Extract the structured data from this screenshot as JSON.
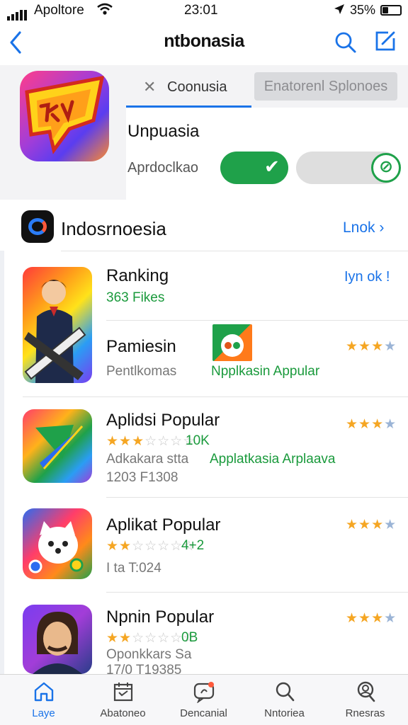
{
  "status_bar": {
    "carrier": "Apoltore",
    "time": "23:01",
    "battery": "35%",
    "battery_level": 0.35
  },
  "nav": {
    "title": "ntbonasia",
    "back_icon": "chevron-left-icon",
    "search_icon": "search-icon",
    "compose_icon": "compose-icon"
  },
  "header": {
    "tab_active": "Coonusia",
    "tab_inactive": "Enatorenl Splonoes",
    "app_name": "Unpuasia",
    "app_sub": "Aprdoclkao",
    "toggle_on": true,
    "toggle_off": false,
    "colors": {
      "accent": "#1a73e8",
      "green": "#1fa14a"
    }
  },
  "section": {
    "title": "Indosrnoesia",
    "link": "Lnok"
  },
  "rows": [
    {
      "title": "Ranking",
      "sub_green": "363 Fikes",
      "link": "Iyn ok !",
      "title2": "Pamiesin",
      "sub2": "Pentlkomas",
      "green2": "Npplkasin Appular",
      "stars": 3
    },
    {
      "title": "Aplidsi Popular",
      "rating": "10K",
      "stars_small": 3,
      "sub": "Adkakara stta",
      "green": "Applatkasia Arplaava",
      "meta": "1203 F1308",
      "stars": 3
    },
    {
      "title": "Aplikat Popular",
      "rating": "4+2",
      "stars_small": 2,
      "meta": "I ta T:024",
      "stars": 3
    },
    {
      "title": "Npnin Popular",
      "rating": "0B",
      "stars_small": 2,
      "sub": "Oponkkars Sa",
      "meta": "17/0 T19385",
      "stars": 3
    }
  ],
  "tabs": [
    {
      "label": "Laye",
      "icon": "home-icon",
      "active": true
    },
    {
      "label": "Abatoneo",
      "icon": "calendar-icon",
      "active": false
    },
    {
      "label": "Dencanial",
      "icon": "chat-icon",
      "active": false
    },
    {
      "label": "Nntoriea",
      "icon": "search-icon",
      "active": false
    },
    {
      "label": "Rnesras",
      "icon": "profile-search-icon",
      "active": false
    }
  ]
}
